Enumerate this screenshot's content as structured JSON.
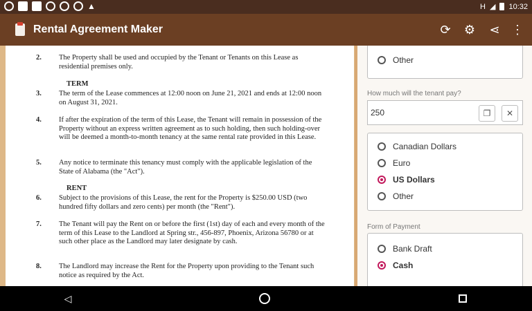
{
  "status_bar": {
    "time": "10:32",
    "signal": "H",
    "icons": [
      "whatsapp-icon",
      "message-icon",
      "mail-icon",
      "whatsapp-icon",
      "youtube-icon",
      "youtube-icon",
      "warning-icon"
    ]
  },
  "app_bar": {
    "title": "Rental Agreement Maker",
    "actions": [
      "refresh-icon",
      "gear-icon",
      "share-icon",
      "more-vert-icon"
    ]
  },
  "document": {
    "items": [
      {
        "num": "2.",
        "text": "The Property shall be used and occupied by the Tenant or Tenants on this Lease as residential premises only."
      },
      {
        "heading": "TERM"
      },
      {
        "num": "3.",
        "text": "The term of the Lease commences at 12:00 noon on June 21, 2021 and ends at 12:00 noon on August 31, 2021."
      },
      {
        "num": "4.",
        "text": "If after the expiration of the term of this Lease, the Tenant will remain in possession of the Property without an express written agreement as to such holding, then such holding-over will be deemed a month-to-month tenancy at the same rental rate provided in this Lease."
      },
      {
        "num": "5.",
        "text": "Any notice to terminate this tenancy must comply with the applicable legislation of the State of Alabama (the \"Act\")."
      },
      {
        "heading": "RENT"
      },
      {
        "num": "6.",
        "text": "Subject to the provisions of this Lease, the rent for the Property is $250.00 USD (two hundred fifty dollars and zero cents) per month (the \"Rent\")."
      },
      {
        "num": "7.",
        "text": "The Tenant will pay the Rent on or before the first (1st) day of each and every month of the term of this Lease to the Landlord at Spring str., 456-897, Phoenix, Arizona 56780 or at such other place as the Landlord may later designate by cash."
      },
      {
        "num": "8.",
        "text": "The Landlord may increase the Rent for the Property upon providing to the Tenant such notice as required by the Act."
      }
    ]
  },
  "form": {
    "top_card_option": "Other",
    "amount_label": "How much will the tenant pay?",
    "amount_value": "250",
    "clear_symbol": "✕",
    "currency_options": [
      "Canadian Dollars",
      "Euro",
      "US Dollars",
      "Other"
    ],
    "currency_selected": "US Dollars",
    "payment_label": "Form of Payment",
    "payment_options": [
      "Bank Draft",
      "Cash"
    ],
    "payment_selected": "Cash"
  }
}
